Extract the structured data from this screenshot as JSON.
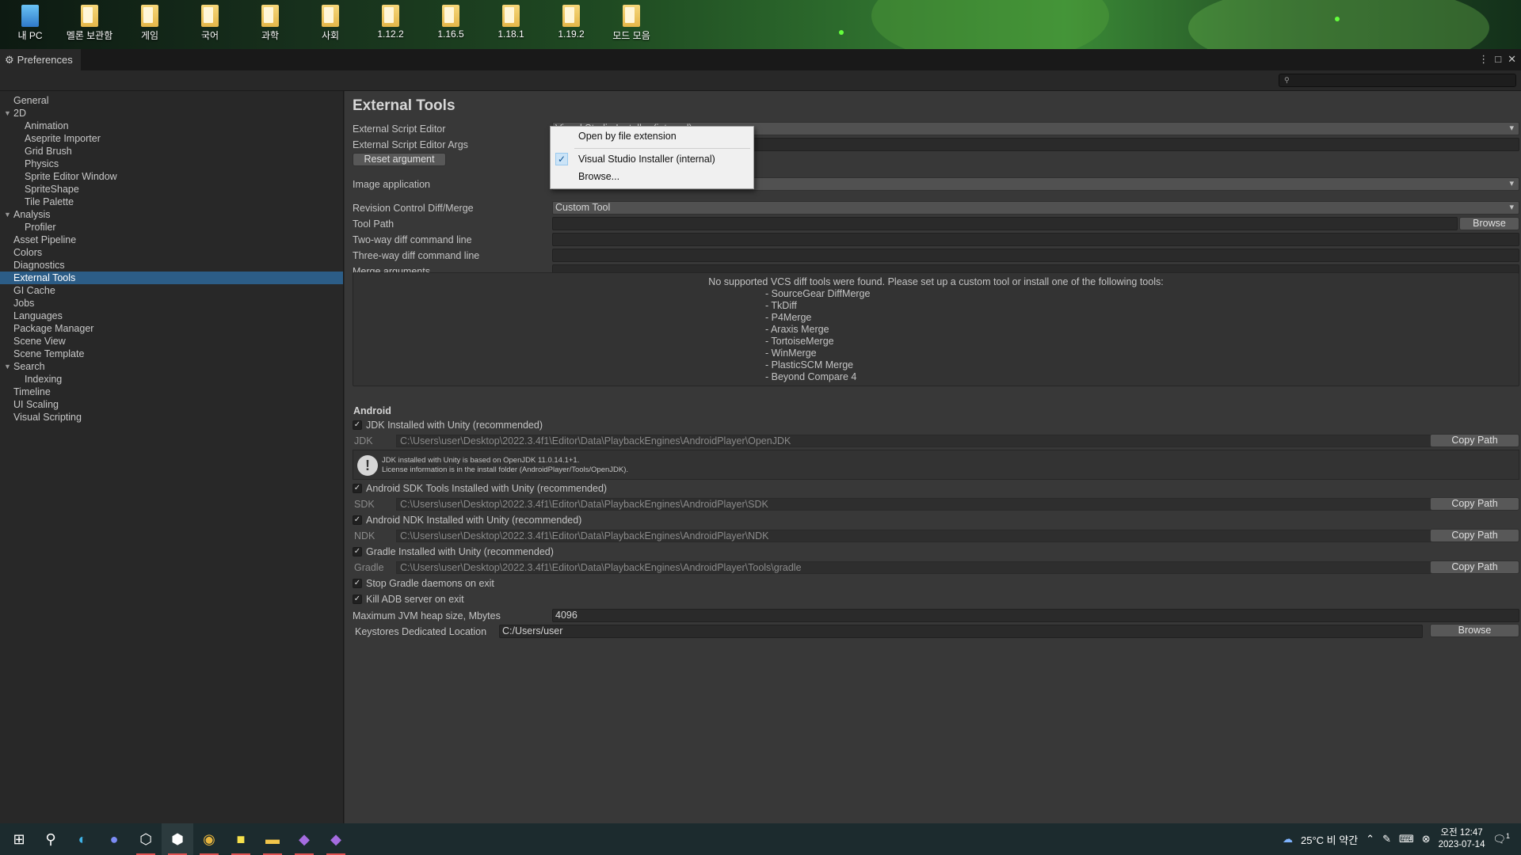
{
  "desktop": {
    "icons": [
      "내 PC",
      "멜론 보관함",
      "게임",
      "국어",
      "과학",
      "사회",
      "1.12.2",
      "1.16.5",
      "1.18.1",
      "1.19.2",
      "모드 모음"
    ]
  },
  "window": {
    "tab_title": "Preferences",
    "search_placeholder": ""
  },
  "sidebar": {
    "items": [
      {
        "label": "General",
        "level": 0
      },
      {
        "label": "2D",
        "level": 0,
        "expanded": true
      },
      {
        "label": "Animation",
        "level": 1
      },
      {
        "label": "Aseprite Importer",
        "level": 1
      },
      {
        "label": "Grid Brush",
        "level": 1
      },
      {
        "label": "Physics",
        "level": 1
      },
      {
        "label": "Sprite Editor Window",
        "level": 1
      },
      {
        "label": "SpriteShape",
        "level": 1
      },
      {
        "label": "Tile Palette",
        "level": 1
      },
      {
        "label": "Analysis",
        "level": 0,
        "expanded": true
      },
      {
        "label": "Profiler",
        "level": 1
      },
      {
        "label": "Asset Pipeline",
        "level": 0
      },
      {
        "label": "Colors",
        "level": 0
      },
      {
        "label": "Diagnostics",
        "level": 0
      },
      {
        "label": "External Tools",
        "level": 0,
        "active": true
      },
      {
        "label": "GI Cache",
        "level": 0
      },
      {
        "label": "Jobs",
        "level": 0
      },
      {
        "label": "Languages",
        "level": 0
      },
      {
        "label": "Package Manager",
        "level": 0
      },
      {
        "label": "Scene View",
        "level": 0
      },
      {
        "label": "Scene Template",
        "level": 0
      },
      {
        "label": "Search",
        "level": 0,
        "expanded": true
      },
      {
        "label": "Indexing",
        "level": 1
      },
      {
        "label": "Timeline",
        "level": 0
      },
      {
        "label": "UI Scaling",
        "level": 0
      },
      {
        "label": "Visual Scripting",
        "level": 0
      }
    ]
  },
  "main": {
    "heading": "External Tools",
    "script_editor_label": "External Script Editor",
    "script_editor_value": "Visual Studio Installer (internal)",
    "script_args_label": "External Script Editor Args",
    "reset_button": "Reset argument",
    "image_app_label": "Image application",
    "rev_control_label": "Revision Control Diff/Merge",
    "rev_control_value": "Custom Tool",
    "tool_path_label": "Tool Path",
    "browse_button": "Browse",
    "two_way_label": "Two-way diff command line",
    "three_way_label": "Three-way diff command line",
    "merge_args_label": "Merge arguments",
    "vcs_message": "No supported VCS diff tools were found. Please set up a custom tool or install one of the following tools:",
    "vcs_tools": [
      "- SourceGear DiffMerge",
      "- TkDiff",
      "- P4Merge",
      "- Araxis Merge",
      "- TortoiseMerge",
      "- WinMerge",
      "- PlasticSCM Merge",
      "- Beyond Compare 4"
    ]
  },
  "android": {
    "section": "Android",
    "jdk_check": "JDK Installed with Unity (recommended)",
    "jdk_label": "JDK",
    "jdk_path": "C:\\Users\\user\\Desktop\\2022.3.4f1\\Editor\\Data\\PlaybackEngines\\AndroidPlayer\\OpenJDK",
    "info_line1": "JDK installed with Unity is based on OpenJDK 11.0.14.1+1.",
    "info_line2": "License information is in the install folder (AndroidPlayer/Tools/OpenJDK).",
    "sdk_check": "Android SDK Tools Installed with Unity (recommended)",
    "sdk_label": "SDK",
    "sdk_path": "C:\\Users\\user\\Desktop\\2022.3.4f1\\Editor\\Data\\PlaybackEngines\\AndroidPlayer\\SDK",
    "ndk_check": "Android NDK Installed with Unity (recommended)",
    "ndk_label": "NDK",
    "ndk_path": "C:\\Users\\user\\Desktop\\2022.3.4f1\\Editor\\Data\\PlaybackEngines\\AndroidPlayer\\NDK",
    "gradle_check": "Gradle Installed with Unity (recommended)",
    "gradle_label": "Gradle",
    "gradle_path": "C:\\Users\\user\\Desktop\\2022.3.4f1\\Editor\\Data\\PlaybackEngines\\AndroidPlayer\\Tools\\gradle",
    "copy_path": "Copy Path",
    "stop_gradle": "Stop Gradle daemons on exit",
    "kill_adb": "Kill ADB server on exit",
    "jvm_label": "Maximum JVM heap size, Mbytes",
    "jvm_value": "4096",
    "keystore_label": "Keystores Dedicated Location",
    "keystore_value": "C:/Users/user",
    "browse_button": "Browse"
  },
  "popup": {
    "items": [
      "Open by file extension",
      "Visual Studio Installer (internal)",
      "Browse..."
    ],
    "checked_index": 1
  },
  "taskbar": {
    "weather": "25°C  비 약간",
    "time": "오전 12:47",
    "date": "2023-07-14",
    "notification_count": "1",
    "icons": [
      "windows-start-icon",
      "search-icon",
      "edge-icon",
      "discord-icon",
      "unity-hub-icon",
      "unity-icon",
      "chrome-icon",
      "kakaotalk-icon",
      "file-explorer-icon",
      "visual-studio-installer-icon",
      "visual-studio-icon"
    ]
  }
}
